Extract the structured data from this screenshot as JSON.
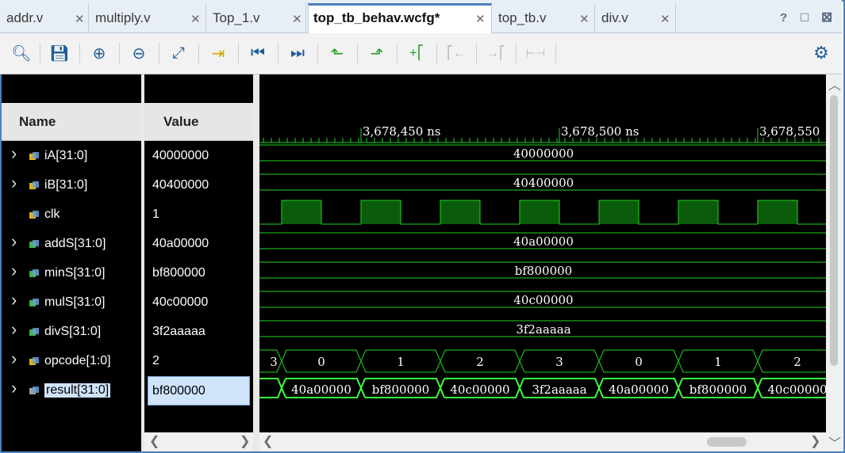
{
  "tabs": [
    {
      "label": "addr.v",
      "active": false
    },
    {
      "label": "multiply.v",
      "active": false
    },
    {
      "label": "Top_1.v",
      "active": false
    },
    {
      "label": "top_tb_behav.wcfg*",
      "active": true
    },
    {
      "label": "top_tb.v",
      "active": false
    },
    {
      "label": "div.v",
      "active": false
    }
  ],
  "window_controls": {
    "help": "?",
    "restore": "□",
    "close": "⊠"
  },
  "toolbar": [
    {
      "name": "search-icon",
      "glyph": "🔍︎",
      "enabled": true
    },
    {
      "name": "save-icon",
      "glyph": "💾︎",
      "enabled": true
    },
    {
      "name": "zoom-in-icon",
      "glyph": "⊕",
      "enabled": true
    },
    {
      "name": "zoom-out-icon",
      "glyph": "⊖",
      "enabled": true
    },
    {
      "name": "zoom-fit-icon",
      "glyph": "⤢",
      "enabled": true
    },
    {
      "name": "go-to-cursor-icon",
      "glyph": "⇥",
      "enabled": true
    },
    {
      "name": "go-to-time-zero-icon",
      "glyph": "⏮",
      "enabled": true
    },
    {
      "name": "go-to-last-time-icon",
      "glyph": "⏭",
      "enabled": true
    },
    {
      "name": "previous-transition-icon",
      "glyph": "⬑",
      "enabled": true
    },
    {
      "name": "next-transition-icon",
      "glyph": "⬏",
      "enabled": true
    },
    {
      "name": "add-marker-icon",
      "glyph": "+⎡",
      "enabled": true
    },
    {
      "name": "previous-marker-icon",
      "glyph": "⎡←",
      "enabled": false
    },
    {
      "name": "next-marker-icon",
      "glyph": "→⎡",
      "enabled": false
    },
    {
      "name": "swap-cursors-icon",
      "glyph": "⊢⊣",
      "enabled": false
    },
    {
      "name": "settings-icon",
      "glyph": "⚙",
      "enabled": true
    }
  ],
  "columns": {
    "name": "Name",
    "value": "Value"
  },
  "signals": [
    {
      "name": "iA[31:0]",
      "value": "40000000",
      "expandable": true,
      "icon": "bus-input"
    },
    {
      "name": "iB[31:0]",
      "value": "40400000",
      "expandable": true,
      "icon": "bus-input"
    },
    {
      "name": "clk",
      "value": "1",
      "expandable": false,
      "icon": "bit-input"
    },
    {
      "name": "addS[31:0]",
      "value": "40a00000",
      "expandable": true,
      "icon": "bus-internal"
    },
    {
      "name": "minS[31:0]",
      "value": "bf800000",
      "expandable": true,
      "icon": "bus-internal"
    },
    {
      "name": "mulS[31:0]",
      "value": "40c00000",
      "expandable": true,
      "icon": "bus-internal"
    },
    {
      "name": "divS[31:0]",
      "value": "3f2aaaaa",
      "expandable": true,
      "icon": "bus-internal"
    },
    {
      "name": "opcode[1:0]",
      "value": "2",
      "expandable": true,
      "icon": "bus-input"
    },
    {
      "name": "result[31:0]",
      "value": "bf800000",
      "expandable": true,
      "icon": "bus-output",
      "selected": true
    }
  ],
  "timeline": {
    "labels": [
      "3,678,450 ns",
      "3,678,500 ns",
      "3,678,550"
    ]
  },
  "waves": {
    "static_values": [
      "40000000",
      "40400000",
      "",
      "40a00000",
      "bf800000",
      "40c00000",
      "3f2aaaaa"
    ],
    "opcode_segments": [
      "3",
      "0",
      "1",
      "2",
      "3",
      "0",
      "1",
      "2"
    ],
    "result_segments": [
      "40a00000",
      "bf800000",
      "40c00000",
      "3f2aaaaa",
      "40a00000",
      "bf800000",
      "40c00000"
    ]
  },
  "colors": {
    "wave": "#1ed41e",
    "clk_fill": "#0a5c0a",
    "result": "#3cff3c",
    "bg": "#000000"
  }
}
